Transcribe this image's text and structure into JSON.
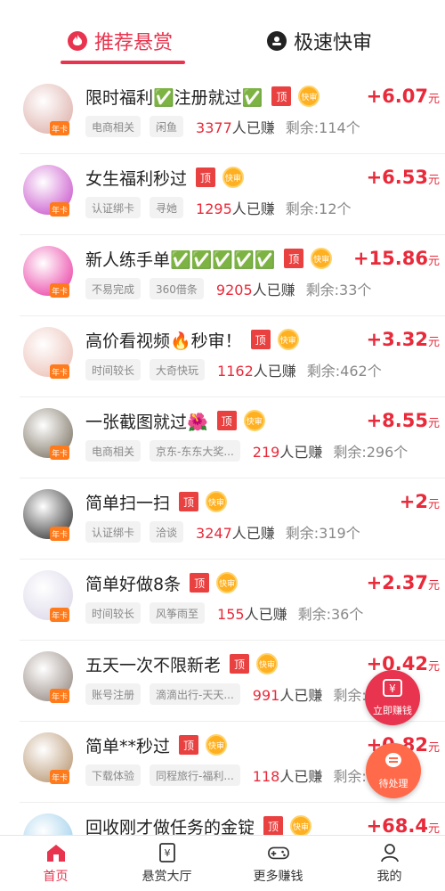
{
  "tabs": {
    "active": {
      "label": "推荐悬赏",
      "icon": "flame-icon"
    },
    "other": {
      "label": "极速快审",
      "icon": "user-badge-icon"
    }
  },
  "badges": {
    "top": "顶",
    "fast": "快审",
    "avatar": "年卡"
  },
  "tasks": [
    {
      "title": "限时福利✅注册就过✅",
      "price": "+6.07",
      "unit": "元",
      "tags": [
        "电商相关",
        "闲鱼"
      ],
      "earned": "3377",
      "earned_suffix": "人已赚",
      "remaining": "剩余:114个",
      "avatar_color": "#d9a6a0"
    },
    {
      "title": "女生福利秒过",
      "price": "+6.53",
      "unit": "元",
      "tags": [
        "认证绑卡",
        "寻她"
      ],
      "earned": "1295",
      "earned_suffix": "人已赚",
      "remaining": "剩余:12个",
      "avatar_color": "#c23fc5"
    },
    {
      "title": "新人练手单✅✅✅✅✅",
      "price": "+15.86",
      "unit": "元",
      "tags": [
        "不易完成",
        "360借条"
      ],
      "earned": "9205",
      "earned_suffix": "人已赚",
      "remaining": "剩余:33个",
      "avatar_color": "#e8289a"
    },
    {
      "title": "高价看视频🔥秒审！",
      "price": "+3.32",
      "unit": "元",
      "tags": [
        "时间较长",
        "大奇快玩"
      ],
      "earned": "1162",
      "earned_suffix": "人已赚",
      "remaining": "剩余:462个",
      "avatar_color": "#e9b8ad"
    },
    {
      "title": "一张截图就过🌺",
      "price": "+8.55",
      "unit": "元",
      "tags": [
        "电商相关",
        "京东-东东大奖..."
      ],
      "earned": "219",
      "earned_suffix": "人已赚",
      "remaining": "剩余:296个",
      "avatar_color": "#6c6250"
    },
    {
      "title": "简单扫一扫",
      "price": "+2",
      "unit": "元",
      "tags": [
        "认证绑卡",
        "洽谈"
      ],
      "earned": "3247",
      "earned_suffix": "人已赚",
      "remaining": "剩余:319个",
      "avatar_color": "#1f1f1f"
    },
    {
      "title": "简单好做8条",
      "price": "+2.37",
      "unit": "元",
      "tags": [
        "时间较长",
        "风筝雨至"
      ],
      "earned": "155",
      "earned_suffix": "人已赚",
      "remaining": "剩余:36个",
      "avatar_color": "#d8d3e6"
    },
    {
      "title": "五天一次不限新老",
      "price": "+0.42",
      "unit": "元",
      "tags": [
        "账号注册",
        "滴滴出行-天天..."
      ],
      "earned": "991",
      "earned_suffix": "人已赚",
      "remaining": "剩余:24个",
      "avatar_color": "#8a7c74"
    },
    {
      "title": "简单**秒过",
      "price": "+0.82",
      "unit": "元",
      "tags": [
        "下载体验",
        "同程旅行-福利..."
      ],
      "earned": "118",
      "earned_suffix": "人已赚",
      "remaining": "剩余:17个",
      "avatar_color": "#b08a62"
    },
    {
      "title": "回收刚才做任务的金锭",
      "price": "+68.4",
      "unit": "元",
      "tags": [],
      "earned": "",
      "earned_suffix": "",
      "remaining": "",
      "avatar_color": "#8fc8e8"
    }
  ],
  "floating": {
    "earn": {
      "icon": "yuan-icon",
      "label": "立即赚钱"
    },
    "pending": {
      "icon": "chat-icon",
      "label": "待处理"
    }
  },
  "nav": [
    {
      "label": "首页",
      "icon": "home-icon",
      "active": true
    },
    {
      "label": "悬赏大厅",
      "icon": "yuan-doc-icon",
      "active": false
    },
    {
      "label": "更多赚钱",
      "icon": "gamepad-icon",
      "active": false
    },
    {
      "label": "我的",
      "icon": "person-icon",
      "active": false
    }
  ],
  "colors": {
    "accent": "#e8344e",
    "price": "#e82a3a",
    "top_badge": "#e94040",
    "fast_badge": "#ffb020"
  }
}
